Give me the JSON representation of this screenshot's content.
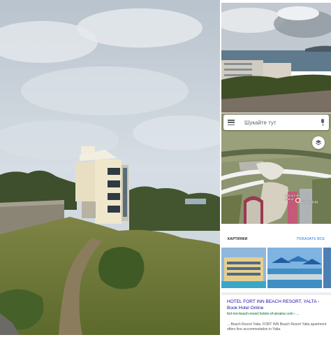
{
  "maps": {
    "search_placeholder": "Шукайте тут",
    "place_label_small": "Курортная\nулица",
    "place_label_main": "FORT INN"
  },
  "search": {
    "images_heading": "КАРТИНКИ",
    "show_all": "ПОКАЗАТЬ ВСЕ",
    "result_title": "HOTEL FORT INN BEACH RESORT, YALTA - Book Hotel Online",
    "result_url": "fort-inn-beach-resort.hotels-of-ukraine.com › ...",
    "result_snippet": "... Beach Resort Yalta. FORT INN Beach Resort Yalta apartment offers fine accommodation in Yalta."
  },
  "colors": {
    "sky": "#c9d2dc",
    "grass": "#6f7a3a",
    "map_road": "#f2f2f2",
    "link": "#1a0dab",
    "url": "#006621"
  },
  "icons": [
    "hamburger-menu-icon",
    "microphone-icon",
    "layers-icon",
    "map-pin-icon"
  ]
}
